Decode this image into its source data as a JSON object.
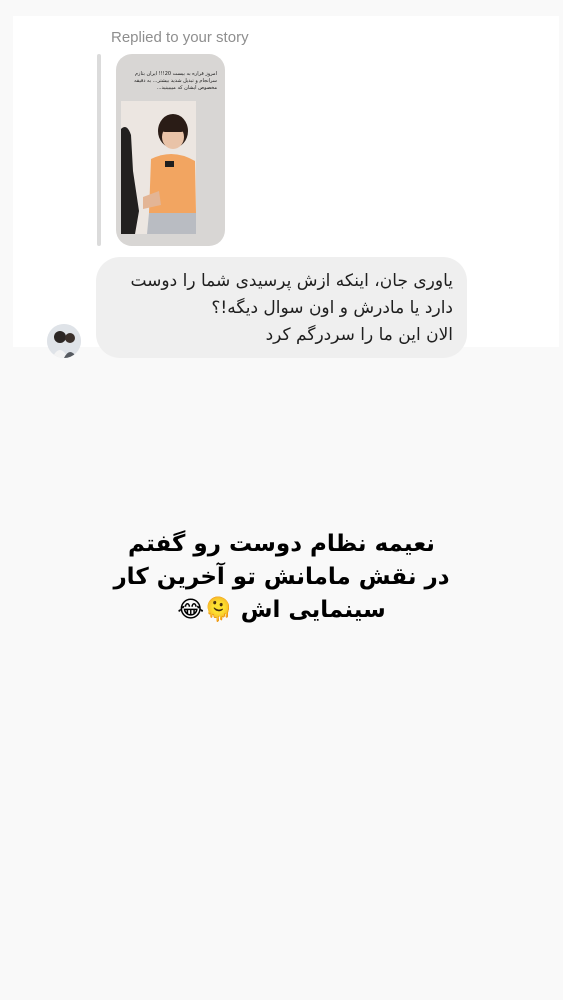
{
  "story_reply": {
    "label": "Replied to your story",
    "story_text": "امروز قراره به بیست 20!!! ایران بتازم سرانجام و تبدیل شدید بیشتر... به دقیقه مخصوص ایشان که مییبینید..."
  },
  "message": {
    "lines": [
      "یاوری جان، اینکه ازش پرسیدی شما را دوست",
      "دارد یا مادرش و اون سوال دیگه!؟",
      "الان این ما را سردرگم کرد"
    ]
  },
  "caption": {
    "lines": [
      "نعیمه نظام دوست رو گفتم",
      "در نقش مامانش تو آخرین کار",
      "سینمایی اش 🫠😂"
    ]
  },
  "colors": {
    "page_background": "#f9f9f9",
    "card_background": "#ffffff",
    "bubble_background": "#efefef",
    "label_gray": "#8e8e8e",
    "shirt_orange": "#f2a561"
  }
}
